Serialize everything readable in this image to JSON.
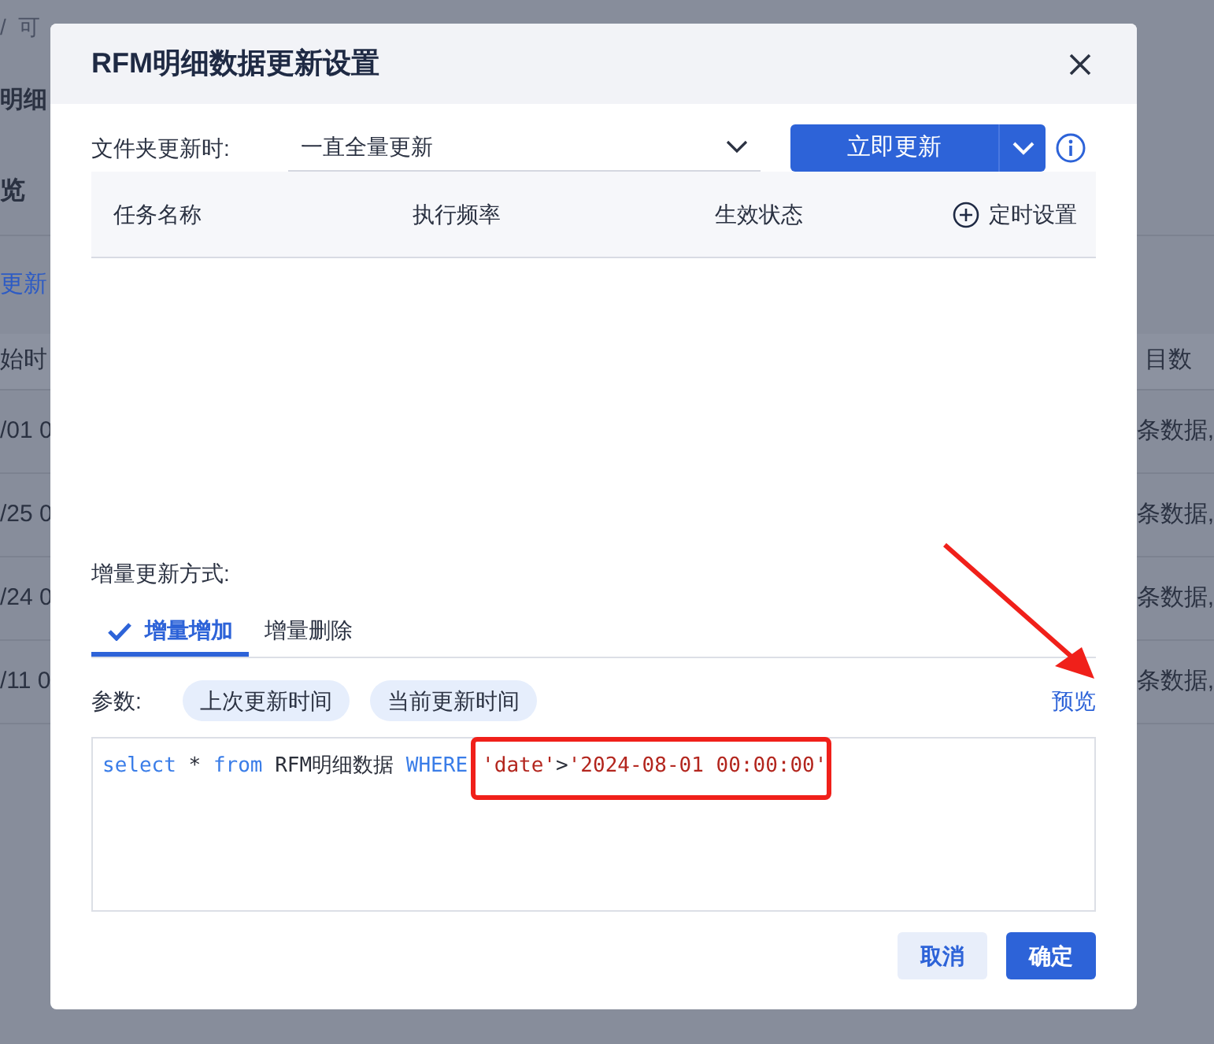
{
  "background": {
    "breadcrumb": "/  可",
    "heading": "明细",
    "section": "览",
    "link": "更新",
    "table": {
      "left_header": "始时",
      "right_header": "目数",
      "rows": [
        {
          "left": "/01 0",
          "right": "条数据,"
        },
        {
          "left": "/25 0",
          "right": "条数据,"
        },
        {
          "left": "/24 0",
          "right": "条数据,"
        },
        {
          "left": "/11 0",
          "right": "条数据,"
        }
      ]
    }
  },
  "dialog": {
    "title": "RFM明细数据更新设置",
    "folder_label": "文件夹更新时:",
    "folder_value": "一直全量更新",
    "update_button": "立即更新",
    "task_table": {
      "columns": [
        "任务名称",
        "执行频率",
        "生效状态"
      ],
      "schedule_button": "定时设置"
    },
    "incremental_label": "增量更新方式:",
    "tabs": [
      {
        "label": "增量增加",
        "selected": true
      },
      {
        "label": "增量删除",
        "selected": false
      }
    ],
    "params_label": "参数:",
    "params": [
      "上次更新时间",
      "当前更新时间"
    ],
    "preview_link": "预览",
    "code": {
      "tokens": [
        {
          "text": "select",
          "kind": "keyword"
        },
        {
          "text": " * ",
          "kind": "plain"
        },
        {
          "text": "from",
          "kind": "keyword"
        },
        {
          "text": " RFM明细数据 ",
          "kind": "plain"
        },
        {
          "text": "WHERE",
          "kind": "keyword"
        }
      ],
      "highlight_tokens": [
        {
          "text": "'date'",
          "kind": "string"
        },
        {
          "text": ">",
          "kind": "plain"
        },
        {
          "text": "'2024-08-01 00:00:00'",
          "kind": "string"
        }
      ]
    },
    "buttons": [
      {
        "label": "取消",
        "kind": "secondary"
      },
      {
        "label": "确定",
        "kind": "primary"
      }
    ]
  }
}
